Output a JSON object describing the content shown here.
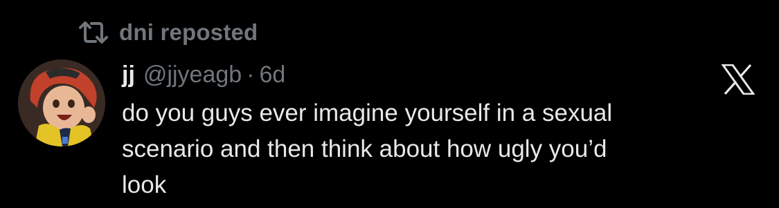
{
  "repost": {
    "icon": "repost-icon",
    "label": "dni reposted"
  },
  "tweet": {
    "avatar_icon": "avatar-anime-character",
    "display_name": "jj",
    "handle": "@jjyeagb",
    "separator": "·",
    "timestamp": "6d",
    "text": "do you guys ever imagine yourself in a sexual\nscenario and then think about how ugly you’d\nlook"
  },
  "brand": {
    "icon": "x-logo-icon"
  },
  "colors": {
    "background": "#000000",
    "primary_text": "#e7e9ea",
    "secondary_text": "#71767b"
  }
}
